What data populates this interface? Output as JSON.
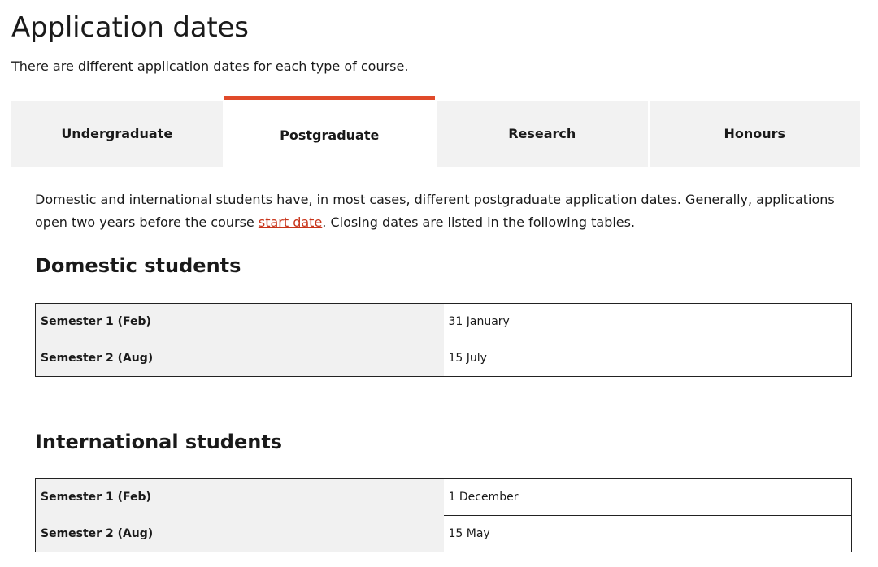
{
  "page": {
    "title": "Application dates",
    "intro": "There are different application dates for each type of course."
  },
  "tabs": [
    {
      "label": "Undergraduate",
      "active": false
    },
    {
      "label": "Postgraduate",
      "active": true
    },
    {
      "label": "Research",
      "active": false
    },
    {
      "label": "Honours",
      "active": false
    }
  ],
  "content": {
    "description_before_link": "Domestic and international students have, in most cases, different postgraduate application dates. Generally, applications open two years before the course ",
    "description_link": "start date",
    "description_after_link": ". Closing dates are listed in the following tables.",
    "domestic": {
      "heading": "Domestic students",
      "rows": [
        {
          "semester": "Semester 1 (Feb)",
          "date": "31 January"
        },
        {
          "semester": "Semester 2 (Aug)",
          "date": "15 July"
        }
      ]
    },
    "international": {
      "heading": "International students",
      "rows": [
        {
          "semester": "Semester 1 (Feb)",
          "date": "1 December"
        },
        {
          "semester": "Semester 2 (Aug)",
          "date": "15 May"
        }
      ]
    }
  },
  "colors": {
    "accent": "#e04a2a",
    "link": "#c8341a",
    "tab_background": "#f2f2f2"
  }
}
